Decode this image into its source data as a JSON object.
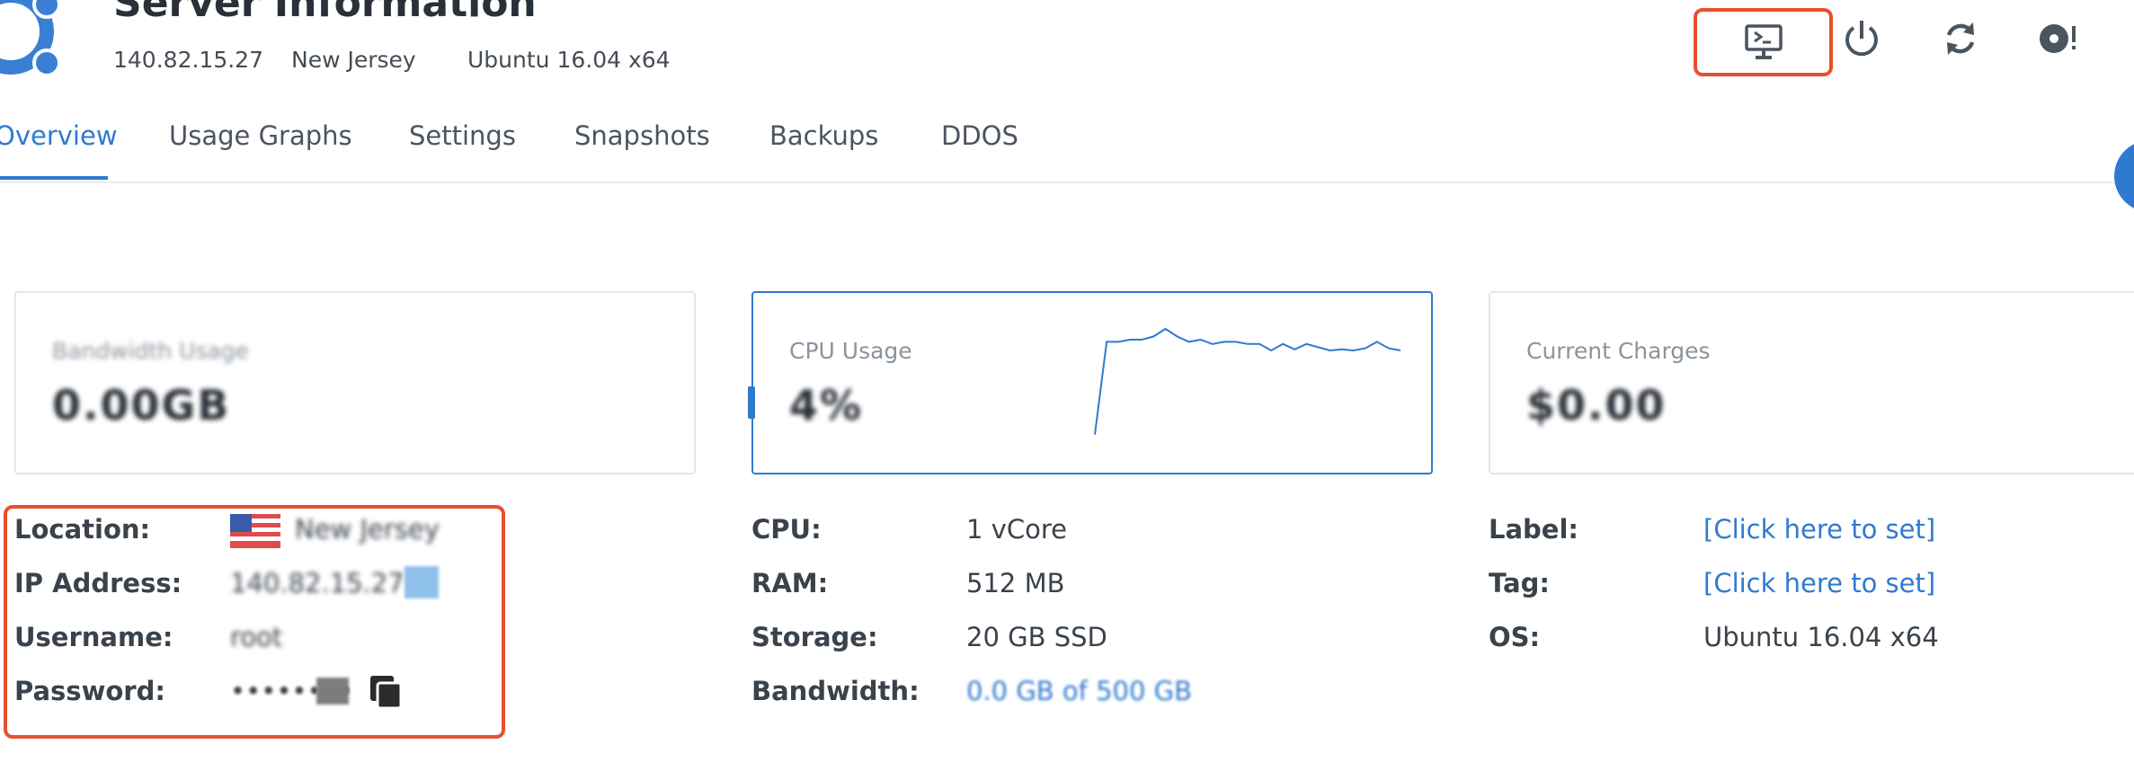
{
  "header": {
    "title": "Server Information",
    "ip": "140.82.15.27",
    "location": "New Jersey",
    "os": "Ubuntu 16.04 x64",
    "icons": [
      "console-icon",
      "power-icon",
      "restart-icon",
      "reinstall-icon"
    ]
  },
  "tabs": [
    {
      "label": "Overview",
      "active": true
    },
    {
      "label": "Usage Graphs"
    },
    {
      "label": "Settings"
    },
    {
      "label": "Snapshots"
    },
    {
      "label": "Backups"
    },
    {
      "label": "DDOS"
    }
  ],
  "cards": {
    "bandwidth": {
      "label": "Bandwidth Usage",
      "value": "0.00GB"
    },
    "cpu": {
      "label": "CPU Usage",
      "value": "4%"
    },
    "charges": {
      "label": "Current Charges",
      "value": "$0.00"
    }
  },
  "cpu_spark": [
    0.02,
    0.88,
    0.88,
    0.9,
    0.9,
    0.93,
    1.0,
    0.93,
    0.88,
    0.9,
    0.86,
    0.88,
    0.88,
    0.86,
    0.86,
    0.8,
    0.86,
    0.81,
    0.86,
    0.83,
    0.8,
    0.81,
    0.8,
    0.82,
    0.88,
    0.82,
    0.8
  ],
  "details_left": [
    {
      "key": "Location:",
      "value": "New Jersey"
    },
    {
      "key": "IP Address:",
      "value": "140.82.15.27"
    },
    {
      "key": "Username:",
      "value": "root"
    },
    {
      "key": "Password:",
      "value": "••••••••"
    }
  ],
  "details_mid": [
    {
      "key": "CPU:",
      "value": "1 vCore"
    },
    {
      "key": "RAM:",
      "value": "512 MB"
    },
    {
      "key": "Storage:",
      "value": "20 GB SSD"
    },
    {
      "key": "Bandwidth:",
      "value": "0.0 GB of 500 GB"
    }
  ],
  "details_right": [
    {
      "key": "Label:",
      "value": "[Click here to set]"
    },
    {
      "key": "Tag:",
      "value": "[Click here to set]"
    },
    {
      "key": "OS:",
      "value": "Ubuntu 16.04 x64"
    }
  ],
  "colors": {
    "accent": "#2f7ad0",
    "highlight": "#e5512e",
    "logo": "#3a7fd4"
  }
}
